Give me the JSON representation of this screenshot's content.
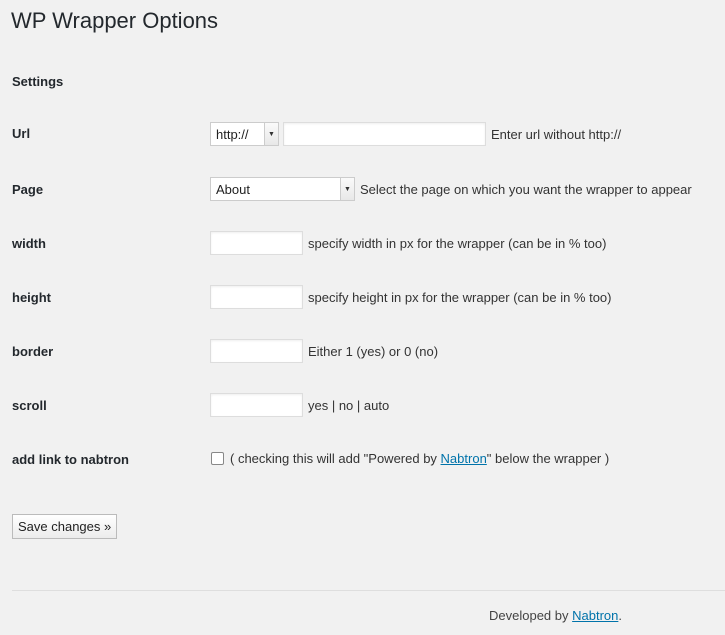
{
  "page": {
    "title": "WP Wrapper Options",
    "section_title": "Settings"
  },
  "form": {
    "url": {
      "label": "Url",
      "protocol_selected": "http://",
      "value": "",
      "description": "Enter url without http://"
    },
    "page": {
      "label": "Page",
      "selected": "About",
      "description": "Select the page on which you want the wrapper to appear"
    },
    "width": {
      "label": "width",
      "value": "",
      "description": "specify width in px for the wrapper (can be in % too)"
    },
    "height": {
      "label": "height",
      "value": "",
      "description": "specify height in px for the wrapper (can be in % too)"
    },
    "border": {
      "label": "border",
      "value": "",
      "description": "Either 1 (yes) or 0 (no)"
    },
    "scroll": {
      "label": "scroll",
      "value": "",
      "description": "yes | no | auto"
    },
    "link": {
      "label": "add link to nabtron",
      "checked": false,
      "description_before": "( checking this will add \"Powered by ",
      "link_text": "Nabtron",
      "description_after": "\" below the wrapper )"
    },
    "save_label": "Save changes »"
  },
  "footer": {
    "prefix": "Developed by ",
    "link_text": "Nabtron",
    "suffix": "."
  }
}
